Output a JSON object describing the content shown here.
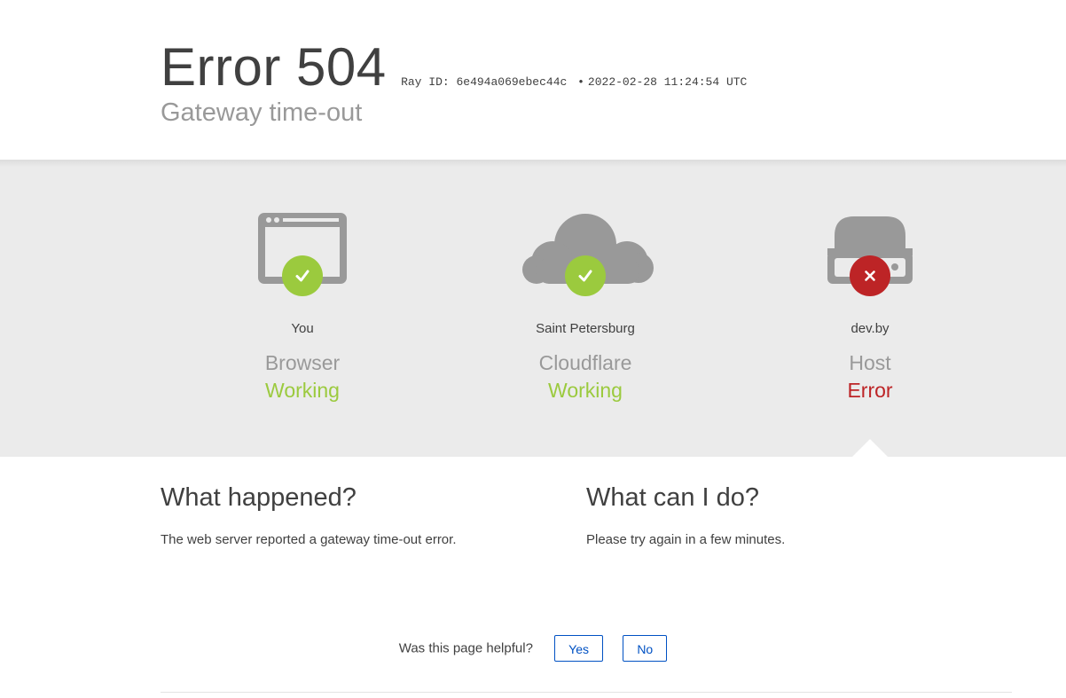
{
  "header": {
    "error_code": "Error 504",
    "ray_id": "Ray ID: 6e494a069ebec44c",
    "separator": "•",
    "timestamp": "2022-02-28 11:24:54 UTC",
    "subtitle": "Gateway time-out"
  },
  "status": [
    {
      "location": "You",
      "kind": "Browser",
      "state": "Working",
      "icon": "browser-icon",
      "ok": true
    },
    {
      "location": "Saint Petersburg",
      "kind": "Cloudflare",
      "state": "Working",
      "icon": "cloud-icon",
      "ok": true
    },
    {
      "location": "dev.by",
      "kind": "Host",
      "state": "Error",
      "icon": "server-icon",
      "ok": false
    }
  ],
  "colors": {
    "ok": "#9bca3e",
    "error": "#bd2426",
    "icon_gray": "#999999",
    "band": "#ebebeb",
    "link": "#0051c3"
  },
  "what_happened": {
    "heading": "What happened?",
    "body": "The web server reported a gateway time-out error."
  },
  "what_can_i_do": {
    "heading": "What can I do?",
    "body": "Please try again in a few minutes."
  },
  "feedback": {
    "question": "Was this page helpful?",
    "yes_label": "Yes",
    "no_label": "No"
  }
}
